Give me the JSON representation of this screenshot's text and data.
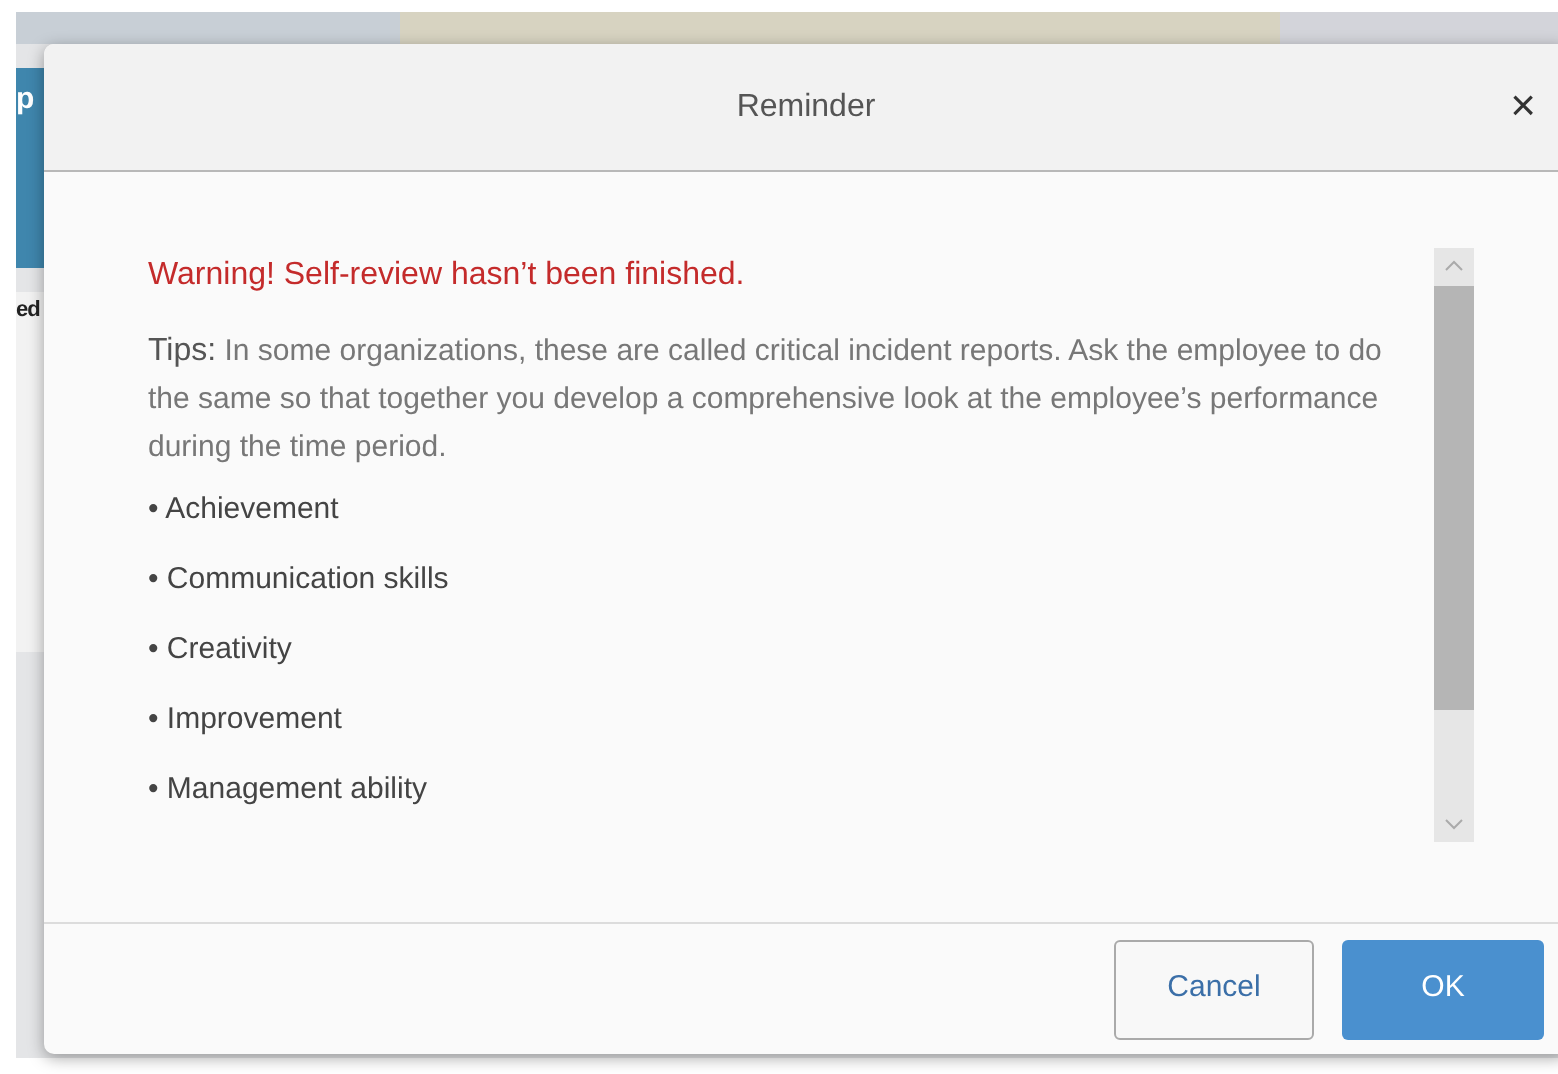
{
  "background": {
    "fragments": [
      "p",
      "ed"
    ]
  },
  "dialog": {
    "title": "Reminder",
    "close": "×",
    "warning": "Warning! Self-review hasn’t been finished.",
    "tips_label": "Tips:",
    "tips_text": "In some organizations, these are called critical incident reports. Ask the employee to do the same so that together you develop a comprehensive look at the employee’s performance during the time period.",
    "items": [
      {
        "bullet": "•",
        "text": "Achievement"
      },
      {
        "bullet": "•",
        "text": "Communication skills"
      },
      {
        "bullet": "•",
        "text": "Creativity"
      },
      {
        "bullet": "•",
        "text": "Improvement"
      },
      {
        "bullet": "•",
        "text": "Management ability"
      }
    ],
    "buttons": [
      {
        "label": "Cancel",
        "kind": "secondary"
      },
      {
        "label": "OK",
        "kind": "primary"
      }
    ]
  }
}
